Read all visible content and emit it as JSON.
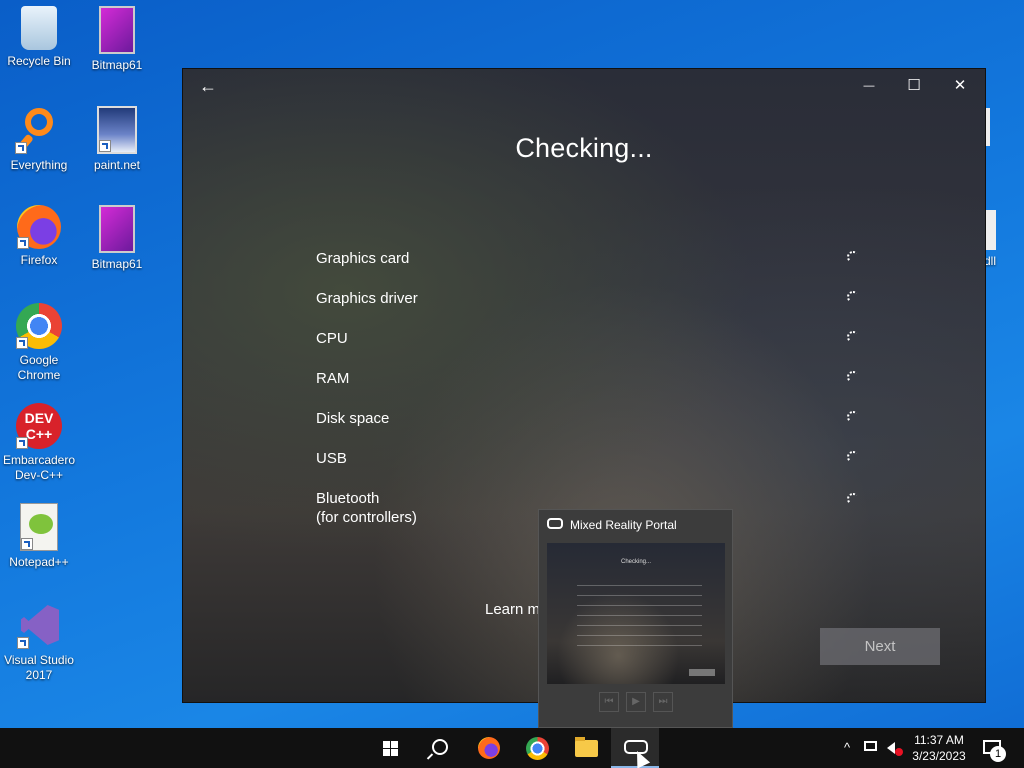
{
  "desktop": {
    "icons": [
      {
        "label": "Recycle Bin"
      },
      {
        "label": "Bitmap61"
      },
      {
        "label": "Everything"
      },
      {
        "label": "paint.net"
      },
      {
        "label": "Firefox"
      },
      {
        "label": "Bitmap61"
      },
      {
        "label": "Google Chrome"
      },
      {
        "label": "Embarcadero Dev-C++"
      },
      {
        "label": "Notepad++"
      },
      {
        "label": "Visual Studio 2017"
      },
      {
        "label": "dll"
      }
    ]
  },
  "window": {
    "back_glyph": "←",
    "minimize_glyph": "—",
    "maximize_glyph": "☐",
    "close_glyph": "✕",
    "heading": "Checking...",
    "requirements": [
      {
        "label": "Graphics card"
      },
      {
        "label": "Graphics driver"
      },
      {
        "label": "CPU"
      },
      {
        "label": "RAM"
      },
      {
        "label": "Disk space"
      },
      {
        "label": "USB"
      },
      {
        "label": "Bluetooth",
        "sublabel": "(for controllers)"
      }
    ],
    "learn_more": "Learn m",
    "next_label": "Next"
  },
  "thumbnail": {
    "title": "Mixed Reality Portal",
    "mini_heading": "Checking...",
    "controls": [
      "⏮",
      "▶",
      "⏭"
    ]
  },
  "taskbar": {
    "time": "11:37 AM",
    "date": "3/23/2023",
    "notification_count": "1",
    "tray_chevron": "^",
    "colors": {
      "active_underline": "#8ab6e8"
    }
  }
}
